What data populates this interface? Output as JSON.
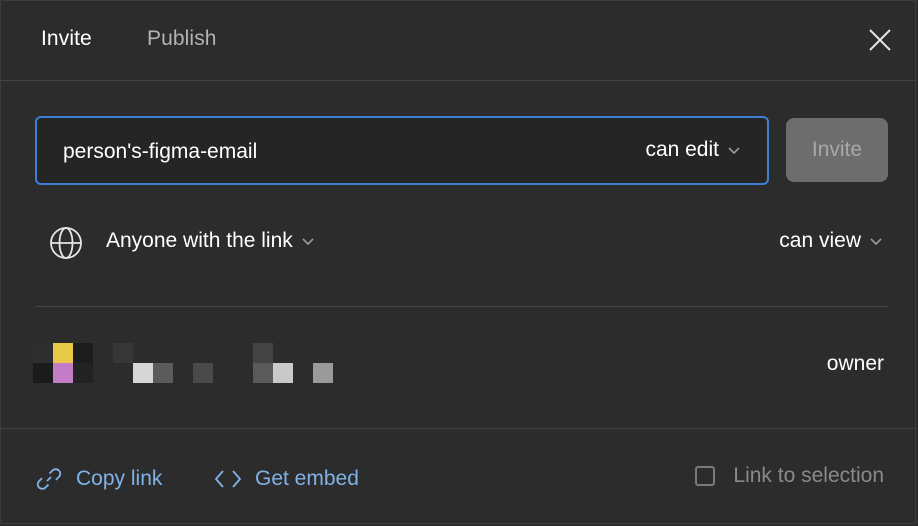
{
  "tabs": [
    {
      "label": "Invite",
      "active": true
    },
    {
      "label": "Publish",
      "active": false
    }
  ],
  "invite": {
    "email_value": "person's-figma-email",
    "permission": "can edit",
    "button_label": "Invite"
  },
  "link_access": {
    "scope": "Anyone with the link",
    "permission": "can view"
  },
  "member": {
    "role": "owner"
  },
  "footer": {
    "copy_link": "Copy link",
    "get_embed": "Get embed",
    "link_to_selection": "Link to selection",
    "link_to_selection_checked": false
  },
  "colors": {
    "background": "#2c2c2c",
    "accent_focus": "#3d7fd6",
    "link": "#7fb3e8",
    "disabled_button": "#6d6d6d"
  },
  "icons": [
    "close-icon",
    "chevron-down-icon",
    "globe-icon",
    "link-icon",
    "code-icon"
  ]
}
